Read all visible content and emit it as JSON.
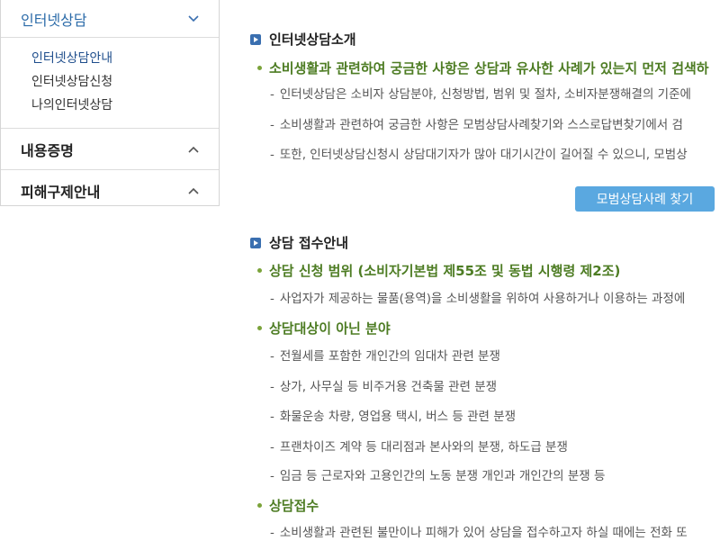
{
  "sidebar": {
    "menus": [
      {
        "label": "인터넷상담",
        "expanded": true,
        "items": [
          "인터넷상담안내",
          "인터넷상담신청",
          "나의인터넷상담"
        ]
      },
      {
        "label": "내용증명",
        "expanded": false
      },
      {
        "label": "피해구제안내",
        "expanded": false
      }
    ]
  },
  "intro": {
    "title": "인터넷상담소개",
    "headline": "소비생활과 관련하여 궁금한 사항은 상담과 유사한 사례가 있는지 먼저 검색하",
    "lines": [
      "인터넷상담은 소비자 상담분야, 신청방법, 범위 및 절차, 소비자분쟁해결의 기준에",
      "소비생활과 관련하여 궁금한 사항은 모범상담사례찾기와 스스로답변찾기에서 검",
      "또한, 인터넷상담신청시 상담대기자가 많아 대기시간이 길어질 수 있으니, 모범상"
    ],
    "button": "모범상담사례 찾기"
  },
  "guide": {
    "title": "상담 접수안내",
    "scope_heading": "상담 신청 범위 (소비자기본법 제55조 및 동법 시행령 제2조)",
    "scope_line": "사업자가 제공하는 물품(용역)을 소비생활을 위하여 사용하거나 이용하는 과정에",
    "excluded_heading": "상담대상이 아닌 분야",
    "excluded": [
      "전월세를 포함한 개인간의 임대차 관련 분쟁",
      "상가, 사무실 등 비주거용 건축물 관련 분쟁",
      "화물운송 차량, 영업용 택시, 버스 등 관련 분쟁",
      "프랜차이즈 계약 등 대리점과 본사와의 분쟁, 하도급 분쟁",
      "임금 등 근로자와 고용인간의 노동 분쟁 개인과 개인간의 분쟁 등"
    ],
    "receipt_heading": "상담접수",
    "receipt_line": "소비생활과 관련된 불만이나 피해가 있어 상담을 접수하고자 하실 때에는 전화 또"
  },
  "icons": {
    "chevron_up": "chevron-up-icon",
    "chevron_down": "chevron-down-icon"
  },
  "colors": {
    "accent_green": "#4d7c23",
    "button_blue": "#5aa8e0",
    "active_menu": "#2a6aa8"
  }
}
